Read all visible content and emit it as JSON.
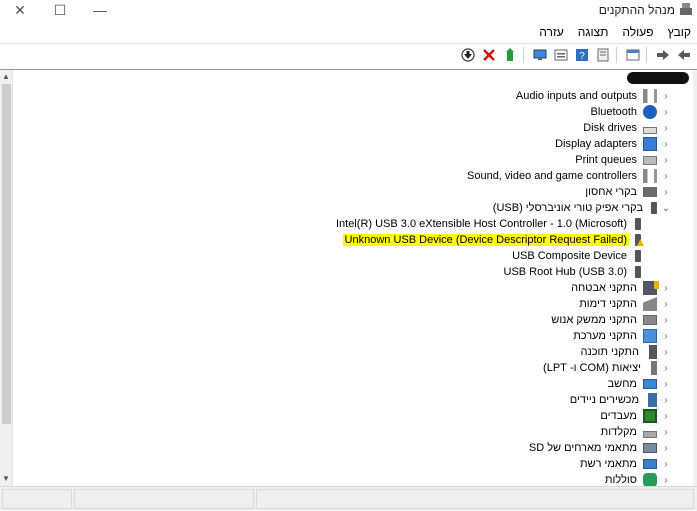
{
  "window": {
    "title": "מנהל ההתקנים",
    "close_glyph": "✕",
    "maximize_glyph": "☐",
    "minimize_glyph": "—"
  },
  "menu": [
    "קובץ",
    "פעולה",
    "תצוגה",
    "עזרה"
  ],
  "toolbar_icons": [
    "back-icon",
    "forward-icon",
    "properties-icon",
    "show-hide-icon",
    "help-icon",
    "details-icon",
    "scan-monitor-icon",
    "update-driver-icon",
    "uninstall-icon",
    "disable-icon"
  ],
  "tree": [
    {
      "label": "Audio inputs and outputs",
      "icon": "speaker-icon",
      "chevron": "‹",
      "expanded": false
    },
    {
      "label": "Bluetooth",
      "icon": "bluetooth-icon",
      "chevron": "‹",
      "expanded": false
    },
    {
      "label": "Disk drives",
      "icon": "disk-icon",
      "chevron": "‹",
      "expanded": false
    },
    {
      "label": "Display adapters",
      "icon": "display-icon",
      "chevron": "‹",
      "expanded": false
    },
    {
      "label": "Print queues",
      "icon": "printer-icon",
      "chevron": "‹",
      "expanded": false
    },
    {
      "label": "Sound, video and game controllers",
      "icon": "speaker-icon",
      "chevron": "‹",
      "expanded": false
    },
    {
      "label": "בקרי אחסון",
      "icon": "storage-icon",
      "chevron": "‹",
      "expanded": false
    },
    {
      "label": "בקרי אפיק טורי אוניברסלי (USB)",
      "icon": "usb-icon",
      "chevron": "⌄",
      "expanded": true
    },
    {
      "label": "Intel(R) USB 3.0 eXtensible Host Controller - 1.0 (Microsoft)",
      "icon": "usb-icon",
      "child": true
    },
    {
      "label": "Unknown USB Device (Device Descriptor Request Failed)",
      "icon": "usb-warning-icon",
      "child": true,
      "highlight": true
    },
    {
      "label": "USB Composite Device",
      "icon": "usb-icon",
      "child": true
    },
    {
      "label": "USB Root Hub (USB 3.0)",
      "icon": "usb-icon",
      "child": true
    },
    {
      "label": "התקני אבטחה",
      "icon": "security-icon",
      "chevron": "‹",
      "expanded": false
    },
    {
      "label": "התקני דימות",
      "icon": "imaging-icon",
      "chevron": "‹",
      "expanded": false
    },
    {
      "label": "התקני ממשק אנוש",
      "icon": "hid-icon",
      "chevron": "‹",
      "expanded": false
    },
    {
      "label": "התקני מערכת",
      "icon": "system-icon",
      "chevron": "‹",
      "expanded": false
    },
    {
      "label": "התקני תוכנה",
      "icon": "software-icon",
      "chevron": "‹",
      "expanded": false
    },
    {
      "label": "יציאות (COM ו- LPT)",
      "icon": "ports-icon",
      "chevron": "‹",
      "expanded": false
    },
    {
      "label": "מחשב",
      "icon": "computer-icon",
      "chevron": "‹",
      "expanded": false
    },
    {
      "label": "מכשירים ניידים",
      "icon": "portable-icon",
      "chevron": "‹",
      "expanded": false
    },
    {
      "label": "מעבדים",
      "icon": "processor-icon",
      "chevron": "‹",
      "expanded": false
    },
    {
      "label": "מקלדות",
      "icon": "keyboard-icon",
      "chevron": "‹",
      "expanded": false
    },
    {
      "label": "מתאמי מארחים של SD",
      "icon": "sd-host-icon",
      "chevron": "‹",
      "expanded": false
    },
    {
      "label": "מתאמי רשת",
      "icon": "network-icon",
      "chevron": "‹",
      "expanded": false
    },
    {
      "label": "סוללות",
      "icon": "battery-icon",
      "chevron": "‹",
      "expanded": false
    }
  ],
  "colors": {
    "highlight": "#ffff00",
    "window_bg": "#ffffff",
    "statusbar_bg": "#f0f0f0"
  }
}
